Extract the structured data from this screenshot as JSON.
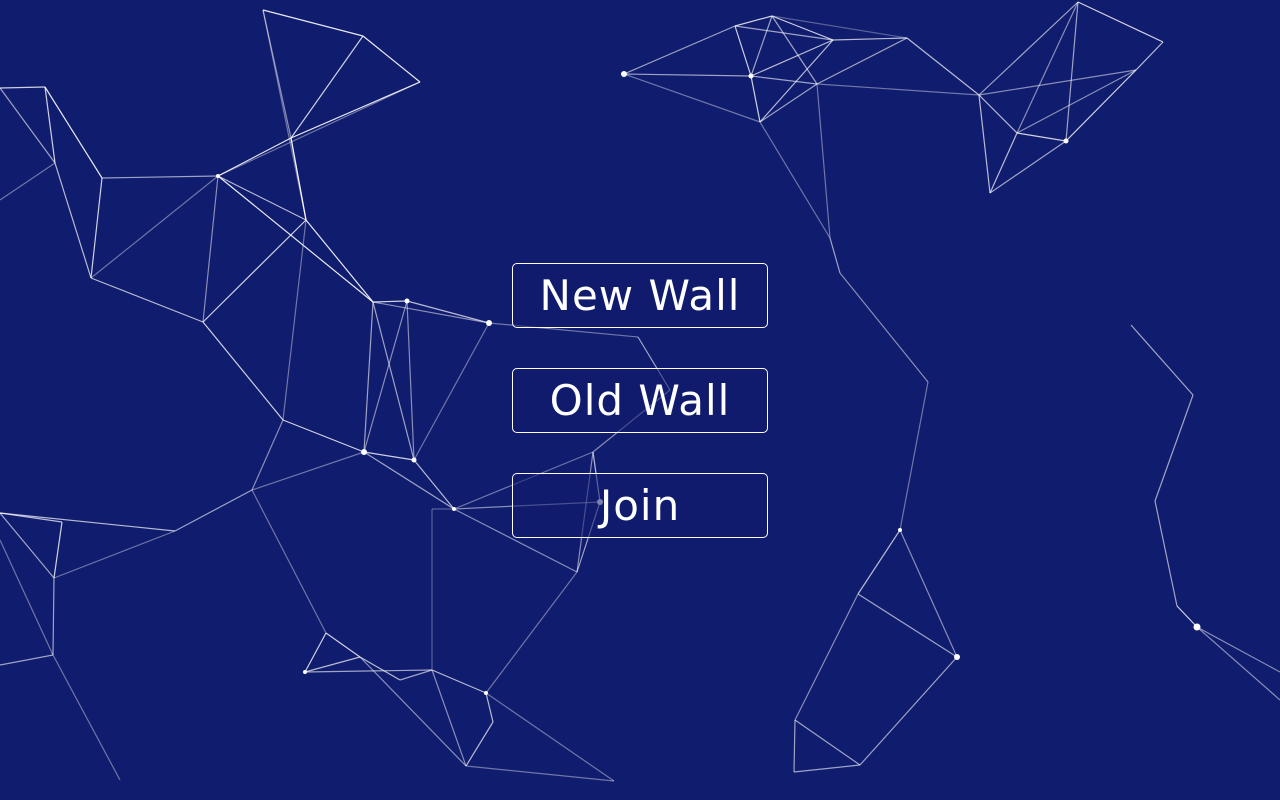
{
  "theme": {
    "background": "#101c6e",
    "foreground": "#ffffff"
  },
  "background": {
    "type": "particle-network",
    "line_color": "#ffffff",
    "node_color": "#ffffff"
  },
  "menu": {
    "buttons": [
      {
        "id": "new-wall",
        "label": "New Wall"
      },
      {
        "id": "old-wall",
        "label": "Old Wall"
      },
      {
        "id": "join",
        "label": "Join"
      }
    ]
  }
}
